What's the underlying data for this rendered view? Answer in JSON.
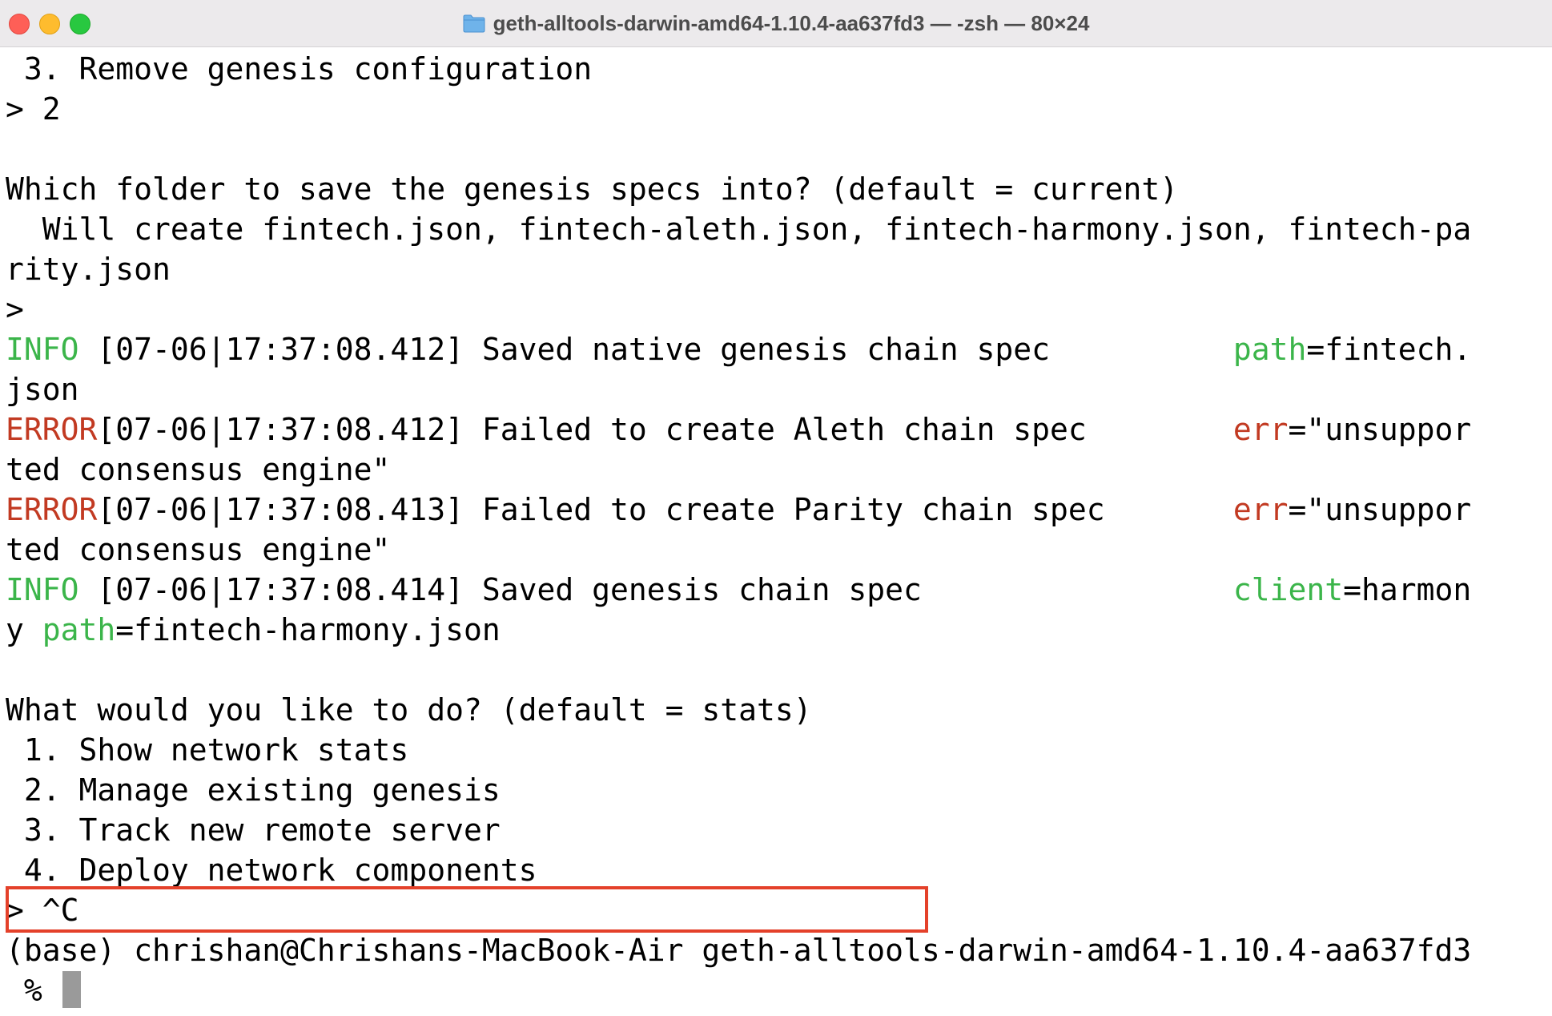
{
  "window": {
    "title": "geth-alltools-darwin-amd64-1.10.4-aa637fd3 — -zsh — 80×24",
    "folder_icon": "folder-icon"
  },
  "terminal": {
    "lines": [
      [
        {
          "t": " 3. Remove genesis configuration"
        }
      ],
      [
        {
          "t": "> 2"
        }
      ],
      [
        {
          "t": ""
        }
      ],
      [
        {
          "t": "Which folder to save the genesis specs into? (default = current)"
        }
      ],
      [
        {
          "t": "  Will create fintech.json, fintech-aleth.json, fintech-harmony.json, fintech-pa"
        }
      ],
      [
        {
          "t": "rity.json"
        }
      ],
      [
        {
          "t": ">"
        }
      ],
      [
        {
          "t": "INFO",
          "c": "g"
        },
        {
          "t": " [07-06|17:37:08.412] Saved native genesis chain spec          "
        },
        {
          "t": "path",
          "c": "g"
        },
        {
          "t": "=fintech."
        }
      ],
      [
        {
          "t": "json"
        }
      ],
      [
        {
          "t": "ERROR",
          "c": "r"
        },
        {
          "t": "[07-06|17:37:08.412] Failed to create Aleth chain spec        "
        },
        {
          "t": "err",
          "c": "r"
        },
        {
          "t": "=\"unsuppor"
        }
      ],
      [
        {
          "t": "ted consensus engine\""
        }
      ],
      [
        {
          "t": "ERROR",
          "c": "r"
        },
        {
          "t": "[07-06|17:37:08.413] Failed to create Parity chain spec       "
        },
        {
          "t": "err",
          "c": "r"
        },
        {
          "t": "=\"unsuppor"
        }
      ],
      [
        {
          "t": "ted consensus engine\""
        }
      ],
      [
        {
          "t": "INFO",
          "c": "g"
        },
        {
          "t": " [07-06|17:37:08.414] Saved genesis chain spec                 "
        },
        {
          "t": "client",
          "c": "g"
        },
        {
          "t": "=harmon"
        }
      ],
      [
        {
          "t": "y "
        },
        {
          "t": "path",
          "c": "g"
        },
        {
          "t": "=fintech-harmony.json"
        }
      ],
      [
        {
          "t": ""
        }
      ],
      [
        {
          "t": "What would you like to do? (default = stats)"
        }
      ],
      [
        {
          "t": " 1. Show network stats"
        }
      ],
      [
        {
          "t": " 2. Manage existing genesis"
        }
      ],
      [
        {
          "t": " 3. Track new remote server"
        }
      ],
      [
        {
          "t": " 4. Deploy network components"
        }
      ],
      [
        {
          "t": "> ^C"
        }
      ],
      [
        {
          "t": "(base) chrishan@Chrishans-MacBook-Air geth-alltools-darwin-amd64-1.10.4-aa637fd3"
        }
      ]
    ],
    "prompt_line": " % ",
    "colors": {
      "info": "#3bb54a",
      "error": "#c23a22",
      "highlight_box": "#e4412a"
    }
  }
}
